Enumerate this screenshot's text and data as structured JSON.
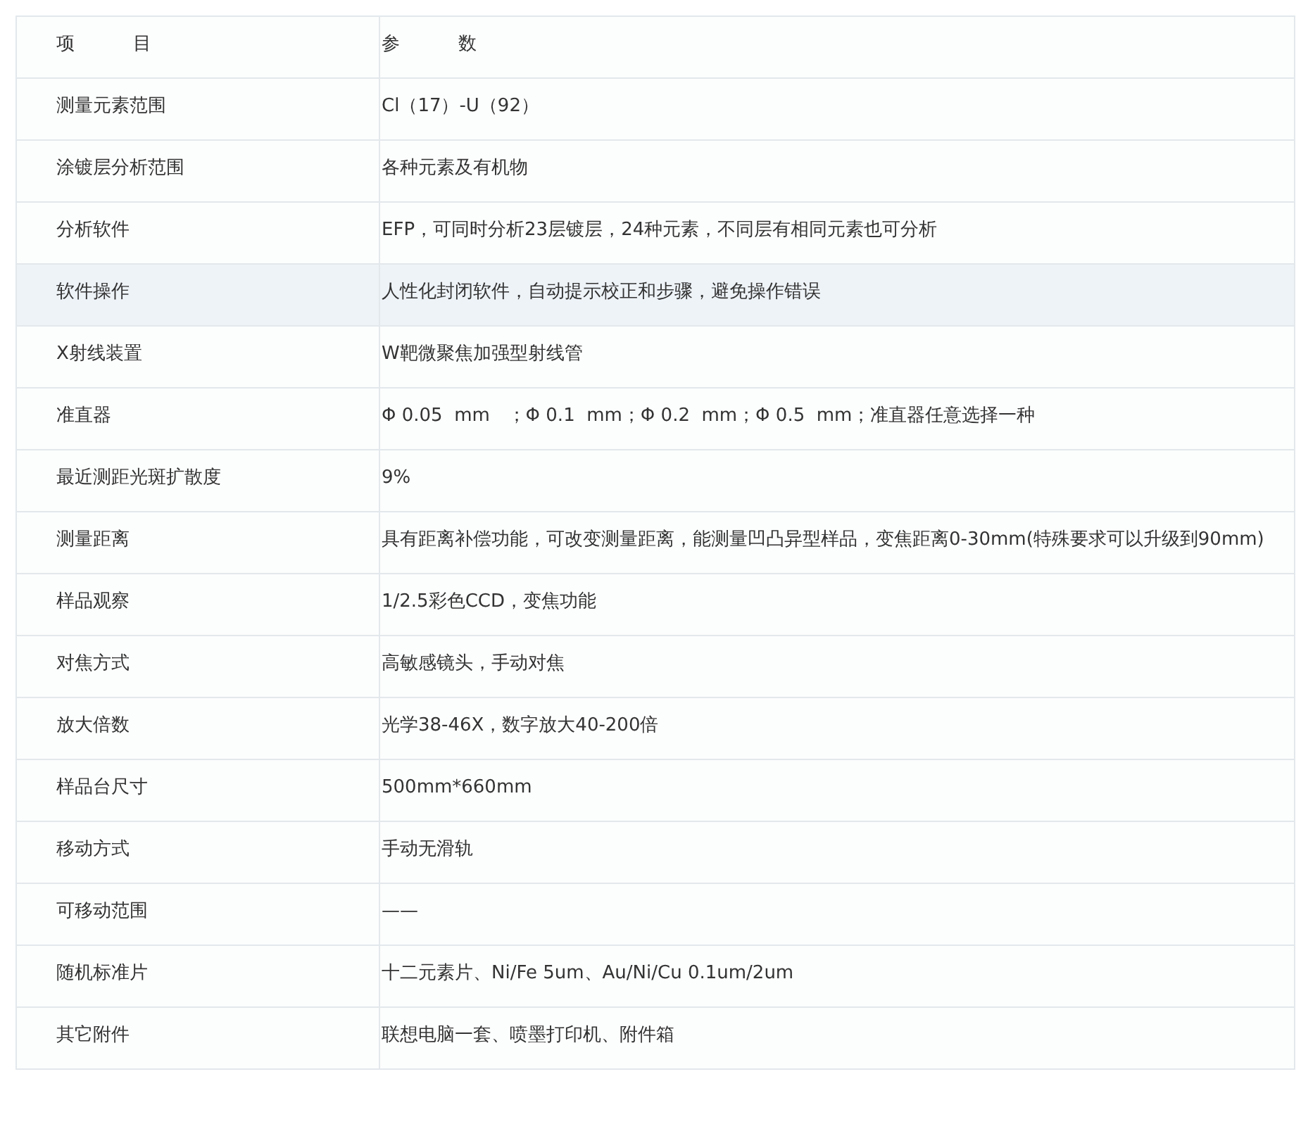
{
  "table": {
    "columns": [
      "项          目",
      "参          数"
    ],
    "rows": [
      {
        "item": "测量元素范围",
        "value": "Cl（17）-U（92）",
        "highlighted": false
      },
      {
        "item": "涂镀层分析范围",
        "value": "各种元素及有机物",
        "highlighted": false
      },
      {
        "item": "分析软件",
        "value": "EFP，可同时分析23层镀层，24种元素，不同层有相同元素也可分析",
        "highlighted": false
      },
      {
        "item": "软件操作",
        "value": "人性化封闭软件，自动提示校正和步骤，避免操作错误",
        "highlighted": true
      },
      {
        "item": "X射线装置",
        "value": "W靶微聚焦加强型射线管",
        "highlighted": false
      },
      {
        "item": "准直器",
        "value": "Φ 0.05  mm   ；Φ 0.1  mm；Φ 0.2  mm；Φ 0.5  mm；准直器任意选择一种",
        "highlighted": false
      },
      {
        "item": "最近测距光斑扩散度",
        "value": "9%",
        "highlighted": false
      },
      {
        "item": "测量距离",
        "value": "具有距离补偿功能，可改变测量距离，能测量凹凸异型样品，变焦距离0-30mm(特殊要求可以升级到90mm)",
        "highlighted": false
      },
      {
        "item": "样品观察",
        "value": "1/2.5彩色CCD，变焦功能",
        "highlighted": false
      },
      {
        "item": "对焦方式",
        "value": "高敏感镜头，手动对焦",
        "highlighted": false
      },
      {
        "item": "放大倍数",
        "value": "光学38-46X，数字放大40-200倍",
        "highlighted": false
      },
      {
        "item": "样品台尺寸",
        "value": "500mm*660mm",
        "highlighted": false
      },
      {
        "item": "移动方式",
        "value": "手动无滑轨",
        "highlighted": false
      },
      {
        "item": "可移动范围",
        "value": "——",
        "highlighted": false
      },
      {
        "item": "随机标准片",
        "value": "十二元素片、Ni/Fe 5um、Au/Ni/Cu 0.1um/2um",
        "highlighted": false
      },
      {
        "item": "其它附件",
        "value": "联想电脑一套、喷墨打印机、附件箱",
        "highlighted": false
      }
    ]
  }
}
